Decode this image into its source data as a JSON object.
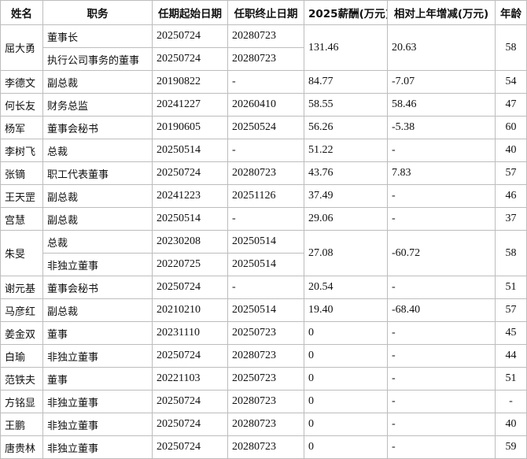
{
  "headers": {
    "name": "姓名",
    "position": "职务",
    "start": "任期起始日期",
    "end": "任职终止日期",
    "salary": "2025薪酬(万元)",
    "change": "相对上年增减(万元)",
    "age": "年龄"
  },
  "people": [
    {
      "name": "屈大勇",
      "roles": [
        {
          "position": "董事长",
          "start": "20250724",
          "end": "20280723"
        },
        {
          "position": "执行公司事务的董事",
          "start": "20250724",
          "end": "20280723"
        }
      ],
      "salary": "131.46",
      "change": "20.63",
      "age": "58"
    },
    {
      "name": "李德文",
      "roles": [
        {
          "position": "副总裁",
          "start": "20190822",
          "end": "-"
        }
      ],
      "salary": "84.77",
      "change": "-7.07",
      "age": "54"
    },
    {
      "name": "何长友",
      "roles": [
        {
          "position": "财务总监",
          "start": "20241227",
          "end": "20260410"
        }
      ],
      "salary": "58.55",
      "change": "58.46",
      "age": "47"
    },
    {
      "name": "杨军",
      "roles": [
        {
          "position": "董事会秘书",
          "start": "20190605",
          "end": "20250524"
        }
      ],
      "salary": "56.26",
      "change": "-5.38",
      "age": "60"
    },
    {
      "name": "李树飞",
      "roles": [
        {
          "position": "总裁",
          "start": "20250514",
          "end": "-"
        }
      ],
      "salary": "51.22",
      "change": "-",
      "age": "40"
    },
    {
      "name": "张镝",
      "roles": [
        {
          "position": "职工代表董事",
          "start": "20250724",
          "end": "20280723"
        }
      ],
      "salary": "43.76",
      "change": "7.83",
      "age": "57"
    },
    {
      "name": "王天罡",
      "roles": [
        {
          "position": "副总裁",
          "start": "20241223",
          "end": "20251126"
        }
      ],
      "salary": "37.49",
      "change": "-",
      "age": "46"
    },
    {
      "name": "宫慧",
      "roles": [
        {
          "position": "副总裁",
          "start": "20250514",
          "end": "-"
        }
      ],
      "salary": "29.06",
      "change": "-",
      "age": "37"
    },
    {
      "name": "朱旻",
      "roles": [
        {
          "position": "总裁",
          "start": "20230208",
          "end": "20250514"
        },
        {
          "position": "非独立董事",
          "start": "20220725",
          "end": "20250514"
        }
      ],
      "salary": "27.08",
      "change": "-60.72",
      "age": "58"
    },
    {
      "name": "谢元基",
      "roles": [
        {
          "position": "董事会秘书",
          "start": "20250724",
          "end": "-"
        }
      ],
      "salary": "20.54",
      "change": "-",
      "age": "51"
    },
    {
      "name": "马彦红",
      "roles": [
        {
          "position": "副总裁",
          "start": "20210210",
          "end": "20250514"
        }
      ],
      "salary": "19.40",
      "change": "-68.40",
      "age": "57"
    },
    {
      "name": "姜金双",
      "roles": [
        {
          "position": "董事",
          "start": "20231110",
          "end": "20250723"
        }
      ],
      "salary": "0",
      "change": "-",
      "age": "45"
    },
    {
      "name": "白瑜",
      "roles": [
        {
          "position": "非独立董事",
          "start": "20250724",
          "end": "20280723"
        }
      ],
      "salary": "0",
      "change": "-",
      "age": "44"
    },
    {
      "name": "范铁夫",
      "roles": [
        {
          "position": "董事",
          "start": "20221103",
          "end": "20250723"
        }
      ],
      "salary": "0",
      "change": "-",
      "age": "51"
    },
    {
      "name": "方铭显",
      "roles": [
        {
          "position": "非独立董事",
          "start": "20250724",
          "end": "20280723"
        }
      ],
      "salary": "0",
      "change": "-",
      "age": "-"
    },
    {
      "name": "王鹏",
      "roles": [
        {
          "position": "非独立董事",
          "start": "20250724",
          "end": "20280723"
        }
      ],
      "salary": "0",
      "change": "-",
      "age": "40"
    },
    {
      "name": "唐贵林",
      "roles": [
        {
          "position": "非独立董事",
          "start": "20250724",
          "end": "20280723"
        }
      ],
      "salary": "0",
      "change": "-",
      "age": "59"
    }
  ]
}
